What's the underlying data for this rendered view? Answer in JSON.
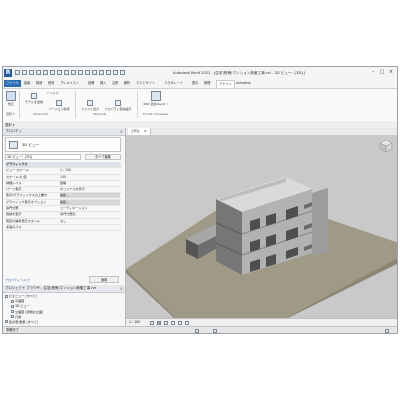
{
  "titlebar": {
    "title": "Autodesk Revit 2022 - [住宅(鉄骨)マンション新築工事.rvt - 3D ビュー: {3D}]",
    "app_button": "R"
  },
  "ribbon_tabs": [
    "ファイル",
    "建築",
    "構造",
    "鉄骨",
    "プレキャスト",
    "設備",
    "挿入",
    "注釈",
    "解析",
    "マスとサイト",
    "コラボレート",
    "表示",
    "管理",
    "アドイン",
    "Autodesk"
  ],
  "active_tab_index": 13,
  "ribbon": {
    "buttons": [
      {
        "label": "修正"
      },
      {
        "label": "モデルを送信"
      },
      {
        "label": "ヘルプ"
      },
      {
        "label": "バージョン情報"
      },
      {
        "label": "ファイル出力"
      },
      {
        "label": "プロパティ変換設定"
      },
      {
        "label": "RKK 変換 Revit ⇒"
      }
    ],
    "panels": [
      "選択 ▾",
      "eTransmit",
      "FKG-Link",
      "Formit Converter"
    ]
  },
  "selection_bar": {
    "label": "選択 ▾"
  },
  "properties": {
    "title": "プロパティ",
    "type_name": "3D ビュー",
    "filter_value": "3D ビュー: {3D}",
    "edit_type_label": "タイプ編集",
    "rows": [
      {
        "k": "グラフィックス",
        "v": "",
        "group": true
      },
      {
        "k": "ビュー スケール",
        "v": "1 : 100"
      },
      {
        "k": "スケール の 値",
        "v": "100"
      },
      {
        "k": "詳細レベル",
        "v": "簡略"
      },
      {
        "k": "パーツ表示",
        "v": "オリジナルを表示"
      },
      {
        "k": "表示/グラフィックスの上書き",
        "v": "編集...",
        "grey": true
      },
      {
        "k": "グラフィック表示オプション",
        "v": "編集...",
        "grey": true
      },
      {
        "k": "専門分野",
        "v": "コーディネーション"
      },
      {
        "k": "隠線を表示",
        "v": "専門分野別"
      },
      {
        "k": "既定の解析表示スタイル",
        "v": "なし"
      },
      {
        "k": "太陽のパス",
        "v": ""
      }
    ],
    "help_link": "プロパティ ヘルプ",
    "apply_label": "適用"
  },
  "browser": {
    "title": "プロジェクト ブラウザ - 住宅(鉄骨)マンション新築工事.rvt",
    "items": [
      {
        "label": "[○] ビュー (すべて)",
        "level": 0
      },
      {
        "label": "平面図",
        "level": 1
      },
      {
        "label": "3D ビュー",
        "level": 1
      },
      {
        "label": "立面図 (建物の立面)",
        "level": 1
      },
      {
        "label": "凡例",
        "level": 1
      },
      {
        "label": "集計表/数量 (すべて)",
        "level": 0
      },
      {
        "label": "シート (すべて)",
        "level": 0
      },
      {
        "label": "ファミリ",
        "level": 0
      },
      {
        "label": "グループ",
        "level": 0
      },
      {
        "label": "Revit リンク",
        "level": 0
      }
    ]
  },
  "view_tab": {
    "label": "{3D}",
    "close": "×"
  },
  "view_bar": {
    "scale": "1 : 100"
  },
  "status": {
    "text": "準備完了"
  }
}
